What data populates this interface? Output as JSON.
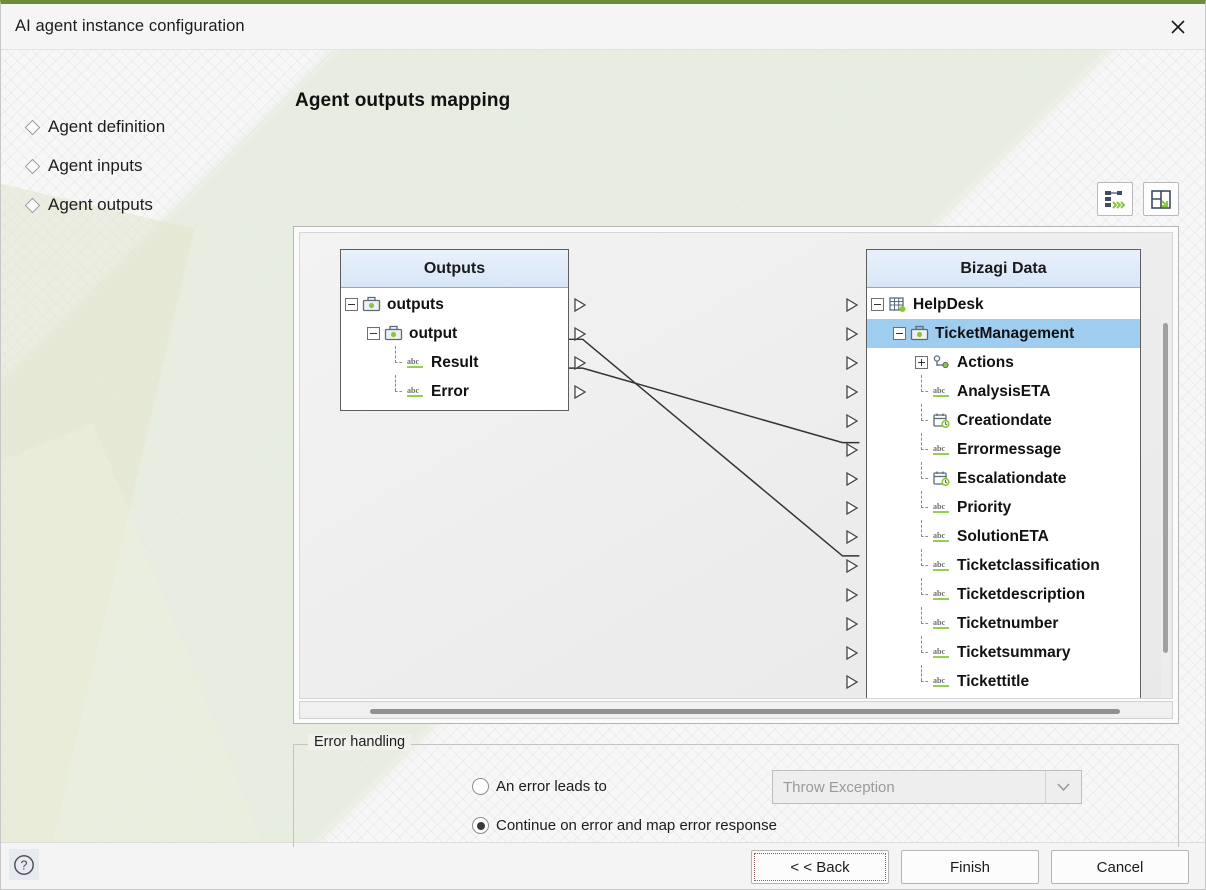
{
  "window": {
    "title": "AI agent instance configuration",
    "close_icon": "close-icon",
    "accent_color": "#6b8c3a"
  },
  "sidebar": {
    "items": [
      {
        "label": "Agent definition",
        "bullet_icon": "diamond-bullet-icon"
      },
      {
        "label": "Agent inputs",
        "bullet_icon": "diamond-bullet-icon"
      },
      {
        "label": "Agent outputs",
        "bullet_icon": "diamond-bullet-icon"
      }
    ]
  },
  "main": {
    "page_title": "Agent outputs mapping",
    "toolbar": [
      {
        "name": "auto-map-button",
        "icon": "auto-map-icon",
        "accent": "#8cc63f"
      },
      {
        "name": "layout-button",
        "icon": "grid-layout-icon",
        "accent": "#8cc63f"
      }
    ]
  },
  "mapper": {
    "source_panel": {
      "header": "Outputs",
      "nodes": [
        {
          "label": "outputs",
          "icon": "briefcase-icon",
          "expander": "minus",
          "level": 0,
          "selected": false
        },
        {
          "label": "output",
          "icon": "briefcase-icon",
          "expander": "minus",
          "level": 1,
          "selected": false
        },
        {
          "label": "Result",
          "icon": "abc-text-icon",
          "expander": "none",
          "level": 2,
          "selected": false
        },
        {
          "label": "Error",
          "icon": "abc-text-icon",
          "expander": "none",
          "level": 2,
          "selected": false
        }
      ]
    },
    "target_panel": {
      "header": "Bizagi Data",
      "nodes": [
        {
          "label": "HelpDesk",
          "icon": "table-icon",
          "expander": "minus",
          "level": 0,
          "selected": false
        },
        {
          "label": "TicketManagement",
          "icon": "briefcase-icon",
          "expander": "minus",
          "level": 1,
          "selected": true
        },
        {
          "label": "Actions",
          "icon": "collection-icon",
          "expander": "plus",
          "level": 2,
          "selected": false
        },
        {
          "label": "AnalysisETA",
          "icon": "abc-text-icon",
          "expander": "none",
          "level": 2,
          "selected": false
        },
        {
          "label": "Creationdate",
          "icon": "date-icon",
          "expander": "none",
          "level": 2,
          "selected": false
        },
        {
          "label": "Errormessage",
          "icon": "abc-text-icon",
          "expander": "none",
          "level": 2,
          "selected": false
        },
        {
          "label": "Escalationdate",
          "icon": "date-icon",
          "expander": "none",
          "level": 2,
          "selected": false
        },
        {
          "label": "Priority",
          "icon": "abc-text-icon",
          "expander": "none",
          "level": 2,
          "selected": false
        },
        {
          "label": "SolutionETA",
          "icon": "abc-text-icon",
          "expander": "none",
          "level": 2,
          "selected": false
        },
        {
          "label": "Ticketclassification",
          "icon": "abc-text-icon",
          "expander": "none",
          "level": 2,
          "selected": false
        },
        {
          "label": "Ticketdescription",
          "icon": "abc-text-icon",
          "expander": "none",
          "level": 2,
          "selected": false
        },
        {
          "label": "Ticketnumber",
          "icon": "abc-text-icon",
          "expander": "none",
          "level": 2,
          "selected": false
        },
        {
          "label": "Ticketsummary",
          "icon": "abc-text-icon",
          "expander": "none",
          "level": 2,
          "selected": false
        },
        {
          "label": "Tickettitle",
          "icon": "abc-text-icon",
          "expander": "none",
          "level": 2,
          "selected": false
        }
      ]
    },
    "connections": [
      {
        "from": "Result",
        "to": "Ticketclassification"
      },
      {
        "from": "Error",
        "to": "Errormessage"
      }
    ]
  },
  "error_handling": {
    "legend": "Error handling",
    "options": [
      {
        "label": "An error leads to",
        "selected": false
      },
      {
        "label": "Continue on error and map error response",
        "selected": true
      }
    ],
    "dropdown": {
      "value": "Throw Exception",
      "disabled": true,
      "icon": "chevron-down-icon"
    }
  },
  "footer": {
    "help_icon": "help-circle-icon",
    "buttons": [
      {
        "label": "< < Back",
        "focused": true
      },
      {
        "label": "Finish",
        "focused": false
      },
      {
        "label": "Cancel",
        "focused": false
      }
    ]
  }
}
